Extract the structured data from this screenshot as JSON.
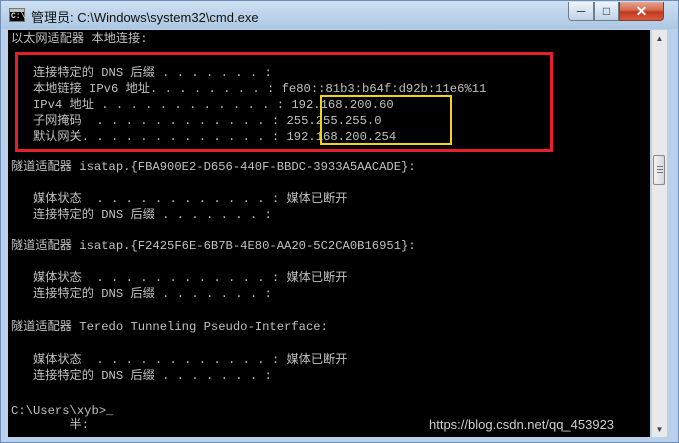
{
  "window": {
    "title": "管理员: C:\\Windows\\system32\\cmd.exe"
  },
  "controls": {
    "minimize": "─",
    "maximize": "□",
    "close": "✕"
  },
  "console": {
    "lines": [
      "以太网适配器 本地连接:",
      "",
      "   连接特定的 DNS 后缀 . . . . . . . :",
      "   本地链接 IPv6 地址. . . . . . . . : fe80::81b3:b64f:d92b:11e6%11",
      "   IPv4 地址 . . . . . . . . . . . . : 192.168.200.60",
      "   子网掩码  . . . . . . . . . . . . : 255.255.255.0",
      "   默认网关. . . . . . . . . . . . . : 192.168.200.254",
      "",
      "隧道适配器 isatap.{FBA900E2-D656-440F-BBDC-3933A5AACADE}:",
      "",
      "   媒体状态  . . . . . . . . . . . . : 媒体已断开",
      "   连接特定的 DNS 后缀 . . . . . . . :",
      "",
      "隧道适配器 isatap.{F2425F6E-6B7B-4E80-AA20-5C2CA0B16951}:",
      "",
      "   媒体状态  . . . . . . . . . . . . : 媒体已断开",
      "   连接特定的 DNS 后缀 . . . . . . . :",
      "",
      "隧道适配器 Teredo Tunneling Pseudo-Interface:",
      "",
      "   媒体状态  . . . . . . . . . . . . : 媒体已断开",
      "   连接特定的 DNS 后缀 . . . . . . . :",
      "",
      "C:\\Users\\xyb>_",
      "        半:"
    ]
  },
  "watermark": "https://blog.csdn.net/qq_453923"
}
